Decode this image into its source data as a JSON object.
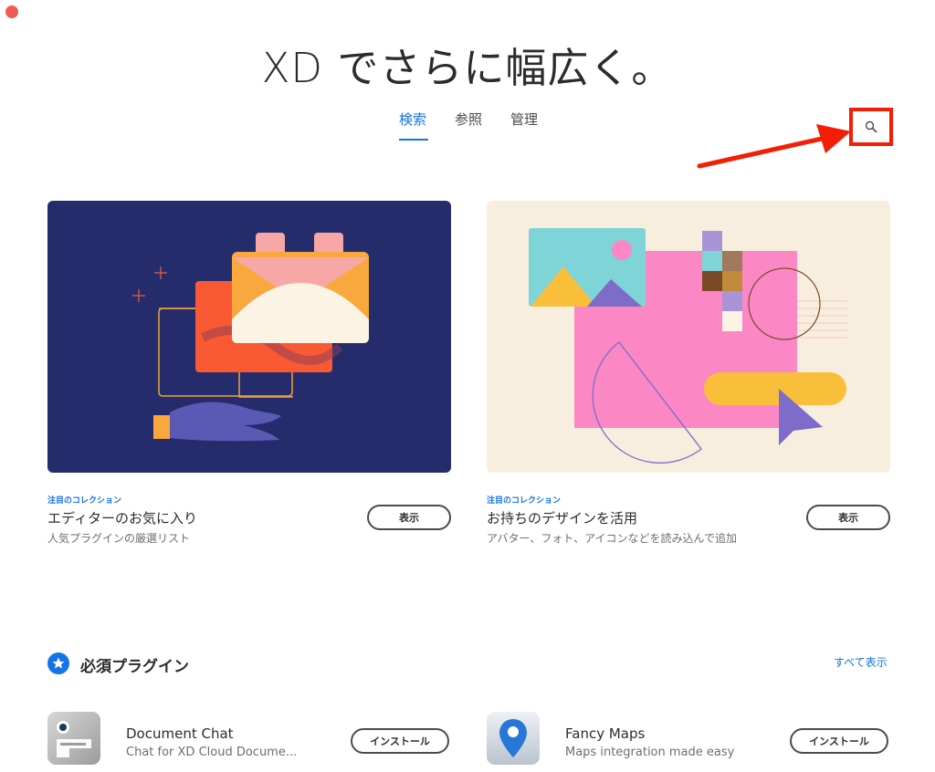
{
  "window": {
    "close_color": "#f05a57"
  },
  "header": {
    "title": "XD でさらに幅広く。",
    "tabs": [
      {
        "label": "検索",
        "active": true
      },
      {
        "label": "参照",
        "active": false
      },
      {
        "label": "管理",
        "active": false
      }
    ],
    "search_icon": "search-icon",
    "accent": "#1473e6",
    "highlight_color": "#f31e05"
  },
  "collections": [
    {
      "eyebrow": "注目のコレクション",
      "title": "エディターのお気に入り",
      "subtitle": "人気プラグインの厳選リスト",
      "button": "表示",
      "bg": "#252c6b"
    },
    {
      "eyebrow": "注目のコレクション",
      "title": "お持ちのデザインを活用",
      "subtitle": "アバター、フォト、アイコンなどを読み込んで追加",
      "button": "表示",
      "bg": "#f7eede"
    }
  ],
  "essentials": {
    "title": "必須プラグイン",
    "see_all": "すべて表示",
    "plugins": [
      {
        "name": "Document Chat",
        "description": "Chat for XD Cloud Docume...",
        "button": "インストール",
        "icon": "document-chat-icon"
      },
      {
        "name": "Fancy Maps",
        "description": "Maps integration made easy",
        "button": "インストール",
        "icon": "map-pin-icon"
      }
    ]
  }
}
